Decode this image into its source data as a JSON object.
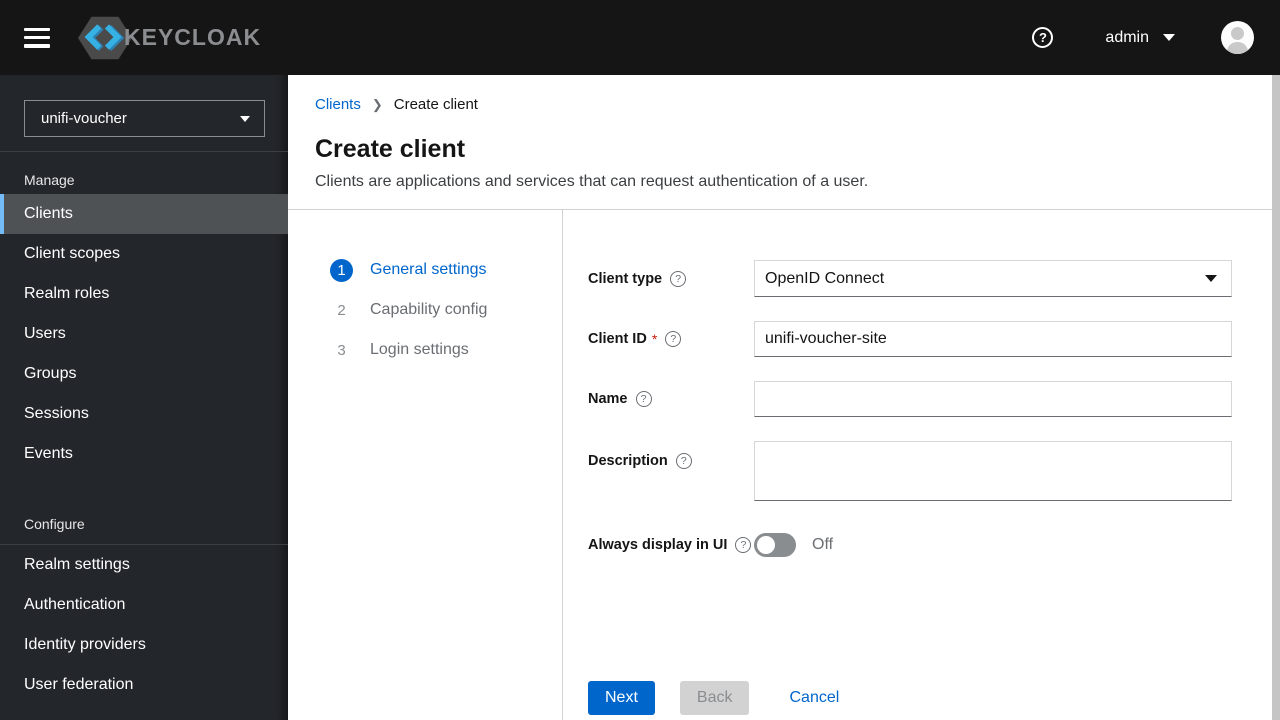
{
  "masthead": {
    "brand": "KEYCLOAK",
    "help_glyph": "?",
    "username": "admin"
  },
  "sidebar": {
    "realm": "unifi-voucher",
    "sections": [
      {
        "heading": "Manage",
        "items": [
          {
            "label": "Clients"
          },
          {
            "label": "Client scopes"
          },
          {
            "label": "Realm roles"
          },
          {
            "label": "Users"
          },
          {
            "label": "Groups"
          },
          {
            "label": "Sessions"
          },
          {
            "label": "Events"
          }
        ]
      },
      {
        "heading": "Configure",
        "items": [
          {
            "label": "Realm settings"
          },
          {
            "label": "Authentication"
          },
          {
            "label": "Identity providers"
          },
          {
            "label": "User federation"
          }
        ]
      }
    ]
  },
  "breadcrumb": {
    "parent": "Clients",
    "separator": "❯",
    "current": "Create client"
  },
  "page": {
    "title": "Create client",
    "subtitle": "Clients are applications and services that can request authentication of a user."
  },
  "wizard": {
    "steps": [
      {
        "number": "1",
        "label": "General settings"
      },
      {
        "number": "2",
        "label": "Capability config"
      },
      {
        "number": "3",
        "label": "Login settings"
      }
    ]
  },
  "form": {
    "help_glyph": "?",
    "client_type": {
      "label": "Client type",
      "value": "OpenID Connect"
    },
    "client_id": {
      "label": "Client ID",
      "required": "*",
      "value": "unifi-voucher-site"
    },
    "name": {
      "label": "Name",
      "value": ""
    },
    "description": {
      "label": "Description",
      "value": ""
    },
    "always_display": {
      "label": "Always display in UI",
      "state": "Off"
    }
  },
  "actions": {
    "next": "Next",
    "back": "Back",
    "cancel": "Cancel"
  },
  "colors": {
    "accent": "#0066cc",
    "masthead_bg": "#151515",
    "sidebar_bg": "#23262a",
    "active_item_bg": "#4f5255",
    "active_stripe": "#73bcf7",
    "danger": "#c9190b"
  }
}
